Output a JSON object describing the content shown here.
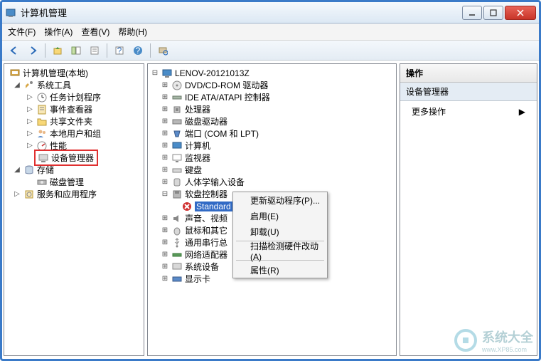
{
  "window": {
    "title": "计算机管理"
  },
  "menubar": {
    "file": "文件(F)",
    "action": "操作(A)",
    "view": "查看(V)",
    "help": "帮助(H)"
  },
  "left_tree": {
    "root": "计算机管理(本地)",
    "system_tools": "系统工具",
    "task_scheduler": "任务计划程序",
    "event_viewer": "事件查看器",
    "shared_folders": "共享文件夹",
    "local_users": "本地用户和组",
    "performance": "性能",
    "device_manager": "设备管理器",
    "storage": "存储",
    "disk_management": "磁盘管理",
    "services": "服务和应用程序"
  },
  "device_tree": {
    "root": "LENOV-20121013Z",
    "dvd": "DVD/CD-ROM 驱动器",
    "ide": "IDE ATA/ATAPI 控制器",
    "cpu": "处理器",
    "disk": "磁盘驱动器",
    "ports": "端口 (COM 和 LPT)",
    "computer": "计算机",
    "monitor": "监视器",
    "keyboard": "键盘",
    "hid": "人体学输入设备",
    "floppy": "软盘控制器",
    "floppy_item": "Standard",
    "sound": "声音、视频",
    "mouse": "鼠标和其它",
    "usb": "通用串行总",
    "network": "网络适配器",
    "sysdev": "系统设备",
    "display": "显示卡"
  },
  "context_menu": {
    "update": "更新驱动程序(P)...",
    "enable": "启用(E)",
    "uninstall": "卸载(U)",
    "scan": "扫描检测硬件改动(A)",
    "properties": "属性(R)"
  },
  "actions_panel": {
    "header": "操作",
    "section": "设备管理器",
    "more": "更多操作"
  },
  "watermark": {
    "text": "系统大全",
    "sub": "www.XP85.com"
  }
}
